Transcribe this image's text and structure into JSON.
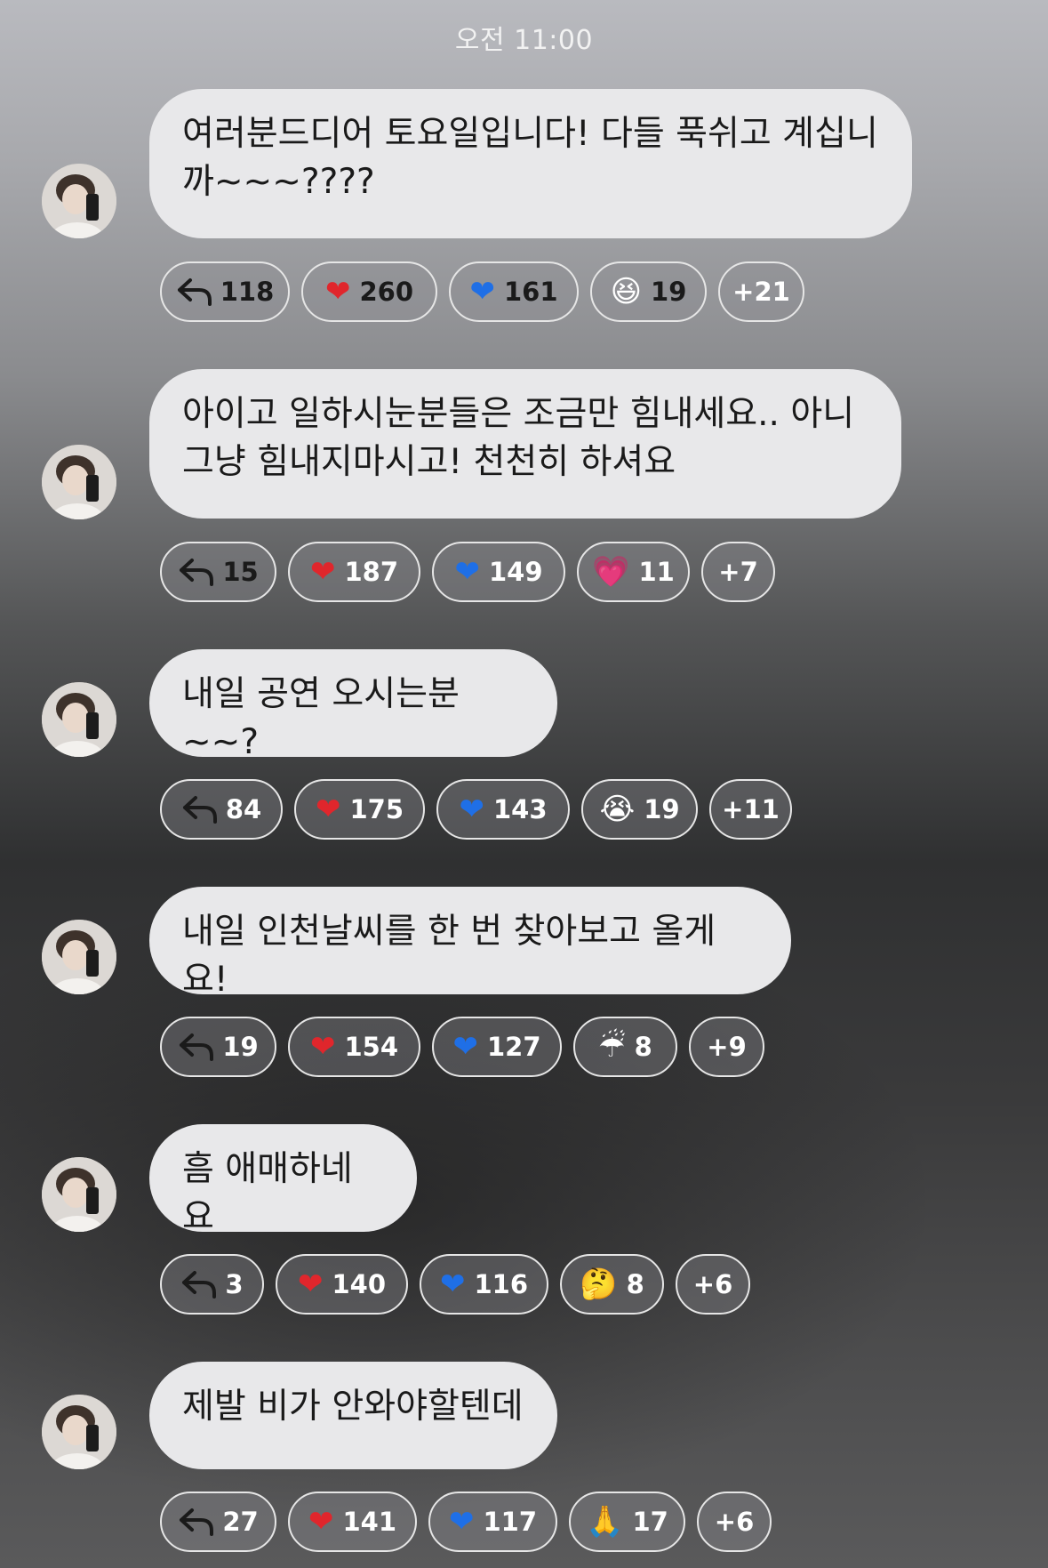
{
  "header": {
    "time": "오전 11:00"
  },
  "messages": [
    {
      "text": "여러분드디어 토요일입니다! 다들 푹쉬고 계십니\n까~~~????",
      "reactions": {
        "reply": "118",
        "red_heart": "260",
        "blue_heart": "161",
        "extra_emoji": "😆",
        "extra_count": "19",
        "more": "+21"
      }
    },
    {
      "text": "아이고 일하시눈분들은 조금만 힘내세요.. 아니\n그냥 힘내지마시고! 천천히 하셔요",
      "reactions": {
        "reply": "15",
        "red_heart": "187",
        "blue_heart": "149",
        "extra_emoji": "💗",
        "extra_count": "11",
        "more": "+7"
      }
    },
    {
      "text": "내일 공연 오시는분~~?",
      "reactions": {
        "reply": "84",
        "red_heart": "175",
        "blue_heart": "143",
        "extra_emoji": "😭",
        "extra_count": "19",
        "more": "+11"
      }
    },
    {
      "text": "내일 인천날씨를 한 번 찾아보고 올게요!",
      "reactions": {
        "reply": "19",
        "red_heart": "154",
        "blue_heart": "127",
        "extra_emoji": "☔",
        "extra_count": "8",
        "more": "+9"
      }
    },
    {
      "text": "흠 애매하네요",
      "reactions": {
        "reply": "3",
        "red_heart": "140",
        "blue_heart": "116",
        "extra_emoji": "🤔",
        "extra_count": "8",
        "more": "+6"
      }
    },
    {
      "text": "제발 비가 안와야할텐데",
      "reactions": {
        "reply": "27",
        "red_heart": "141",
        "blue_heart": "117",
        "extra_emoji": "🙏",
        "extra_count": "17",
        "more": "+6"
      }
    }
  ],
  "icons": {
    "reply": "reply-arrow-icon",
    "red_heart": "red-heart-icon",
    "blue_heart": "blue-heart-icon",
    "avatar": "user-avatar"
  },
  "colors": {
    "bubble": "#e8e8ea",
    "chip_border": "#e6e6e6",
    "red_heart": "#e0262c",
    "blue_heart": "#1f6fe6"
  }
}
